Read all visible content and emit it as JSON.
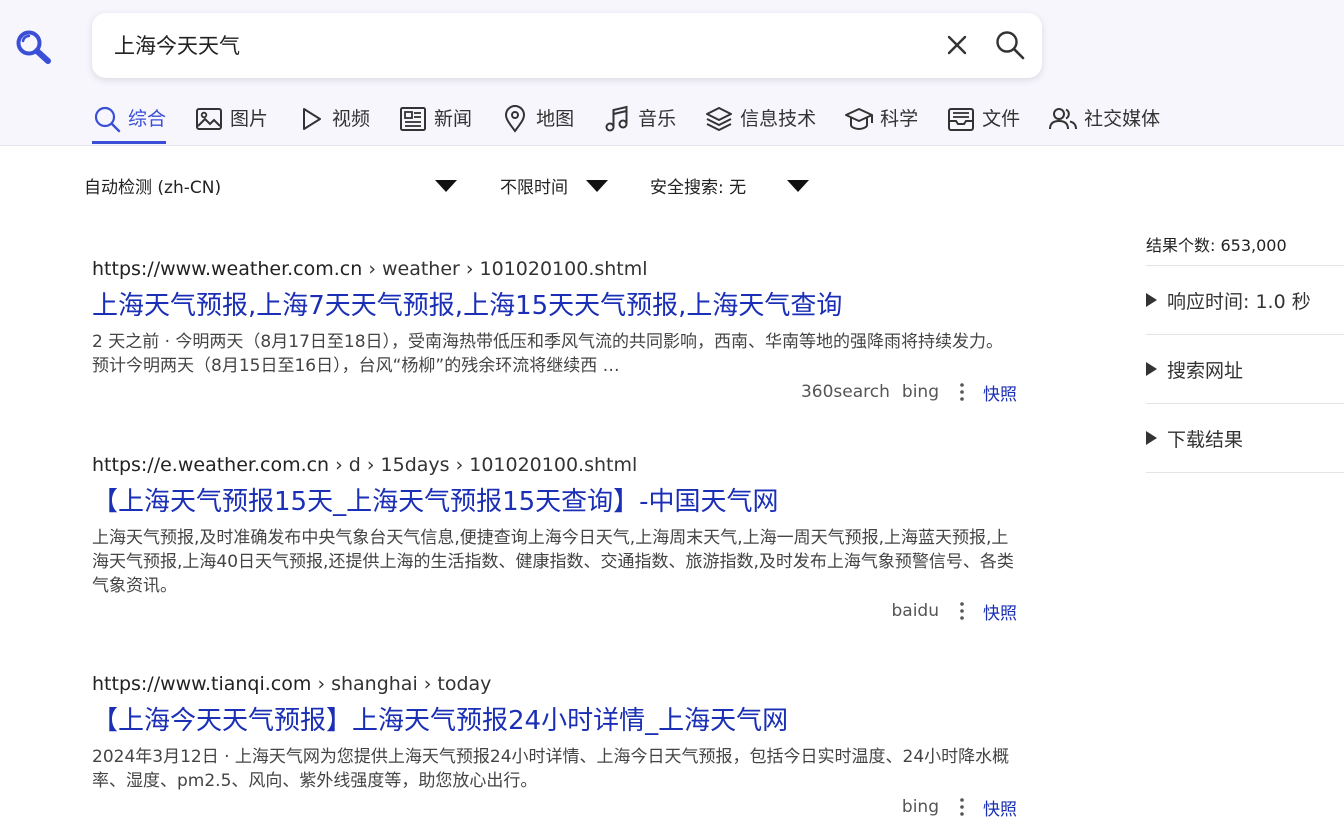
{
  "search": {
    "query": "上海今天天气"
  },
  "tabs": [
    {
      "label": "综合",
      "icon": "search-icon",
      "active": true
    },
    {
      "label": "图片",
      "icon": "image-icon"
    },
    {
      "label": "视频",
      "icon": "play-icon"
    },
    {
      "label": "新闻",
      "icon": "newspaper-icon"
    },
    {
      "label": "地图",
      "icon": "map-pin-icon"
    },
    {
      "label": "音乐",
      "icon": "music-note-icon"
    },
    {
      "label": "信息技术",
      "icon": "layers-icon"
    },
    {
      "label": "科学",
      "icon": "graduation-cap-icon"
    },
    {
      "label": "文件",
      "icon": "inbox-icon"
    },
    {
      "label": "社交媒体",
      "icon": "users-icon"
    }
  ],
  "filters": {
    "language": "自动检测 (zh-CN)",
    "time": "不限时间",
    "safe_search": "安全搜索: 无"
  },
  "results": [
    {
      "url_host": "https://www.weather.com.cn",
      "url_path": "› weather › 101020100.shtml",
      "title": "上海天气预报,上海7天天气预报,上海15天天气预报,上海天气查询",
      "snippet": "2 天之前 · 今明两天（8月17日至18日），受南海热带低压和季风气流的共同影响，西南、华南等地的强降雨将持续发力。 预计今明两天（8月15日至16日），台风“杨柳”的残余环流将继续西 …",
      "engines": [
        "360search",
        "bing"
      ],
      "cache_label": "快照"
    },
    {
      "url_host": "https://e.weather.com.cn",
      "url_path": "› d › 15days › 101020100.shtml",
      "title": "【上海天气预报15天_上海天气预报15天查询】-中国天气网",
      "snippet": "上海天气预报,及时准确发布中央气象台天气信息,便捷查询上海今日天气,上海周末天气,上海一周天气预报,上海蓝天预报,上海天气预报,上海40日天气预报,还提供上海的生活指数、健康指数、交通指数、旅游指数,及时发布上海气象预警信号、各类气象资讯。",
      "engines": [
        "baidu"
      ],
      "cache_label": "快照"
    },
    {
      "url_host": "https://www.tianqi.com",
      "url_path": "› shanghai › today",
      "title": "【上海今天天气预报】上海天气预报24小时详情_上海天气网",
      "snippet": "2024年3月12日 · 上海天气网为您提供上海天气预报24小时详情、上海今日天气预报，包括今日实时温度、24小时降水概率、湿度、pm2.5、风向、紫外线强度等，助您放心出行。",
      "engines": [
        "bing"
      ],
      "cache_label": "快照"
    }
  ],
  "sidebar": {
    "count": "结果个数: 653,000",
    "items": [
      "响应时间: 1.0 秒",
      "搜索网址",
      "下载结果"
    ]
  },
  "colors": {
    "accent": "#3a4fd6",
    "link": "#1a2fb5",
    "header_bg": "#f7f6fd"
  }
}
